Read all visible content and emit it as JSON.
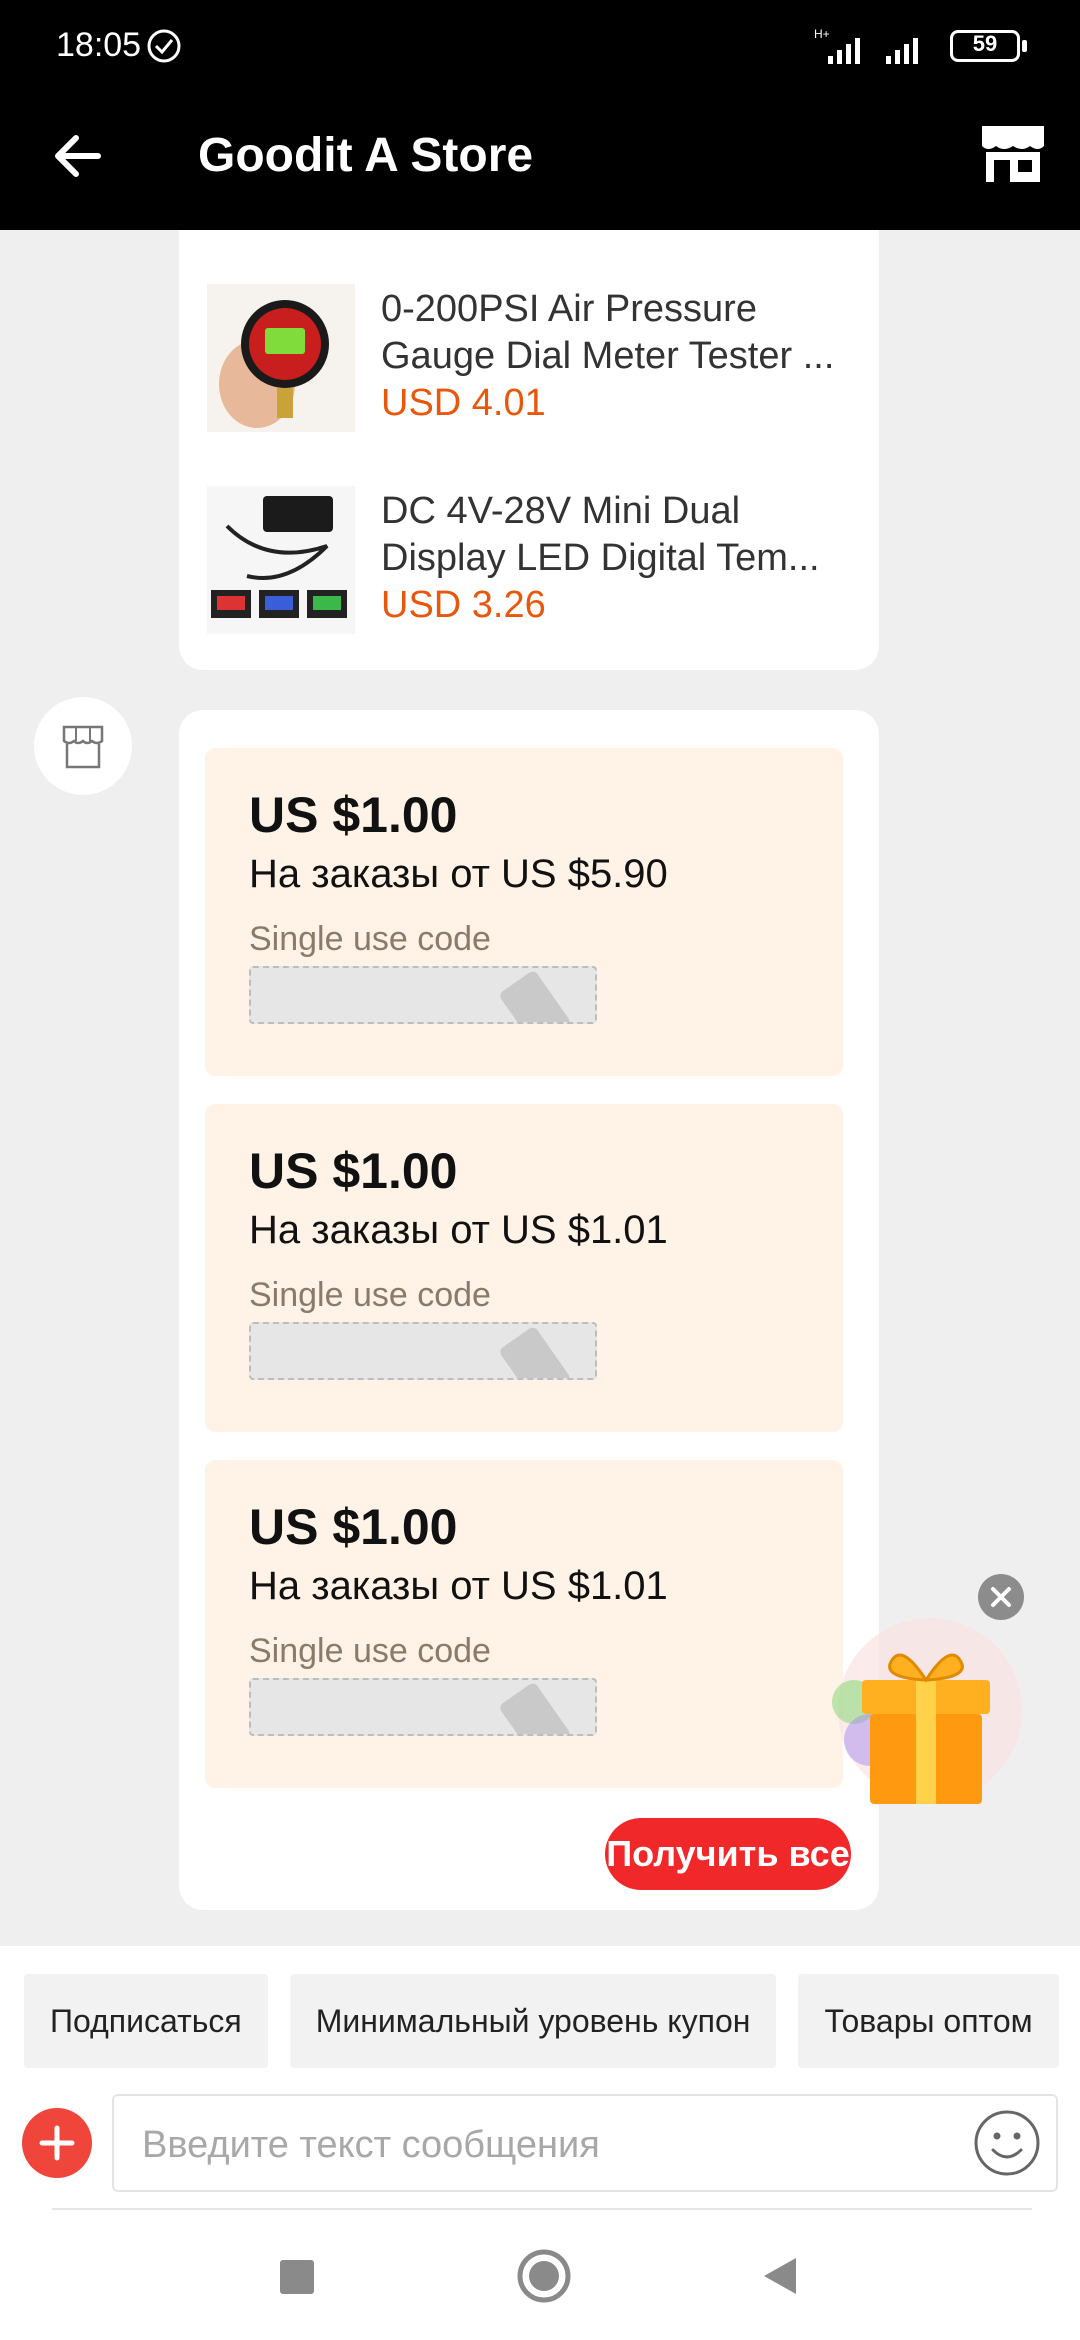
{
  "status_bar": {
    "time": "18:05",
    "battery": "59",
    "network": "H+"
  },
  "header": {
    "title": "Goodit A Store"
  },
  "products": [
    {
      "name": "0-200PSI Air Pressure Gauge Dial Meter Tester ...",
      "price": "USD 4.01"
    },
    {
      "name": "DC 4V-28V Mini Dual Display LED Digital Tem...",
      "price": "USD 3.26"
    }
  ],
  "coupons": [
    {
      "amount": "US $1.00",
      "condition": "На заказы от US $5.90",
      "note": "Single use code"
    },
    {
      "amount": "US $1.00",
      "condition": "На заказы от US $1.01",
      "note": "Single use code"
    },
    {
      "amount": "US $1.00",
      "condition": "На заказы от US $1.01",
      "note": "Single use code"
    }
  ],
  "get_all_label": "Получить все",
  "quick_replies": [
    "Подписаться",
    "Минимальный уровень купон",
    "Товары оптом"
  ],
  "composer": {
    "placeholder": "Введите текст сообщения"
  },
  "colors": {
    "price": "#e8580c",
    "coupon_bg": "#fff2e6",
    "accent_red": "#f0282a"
  }
}
